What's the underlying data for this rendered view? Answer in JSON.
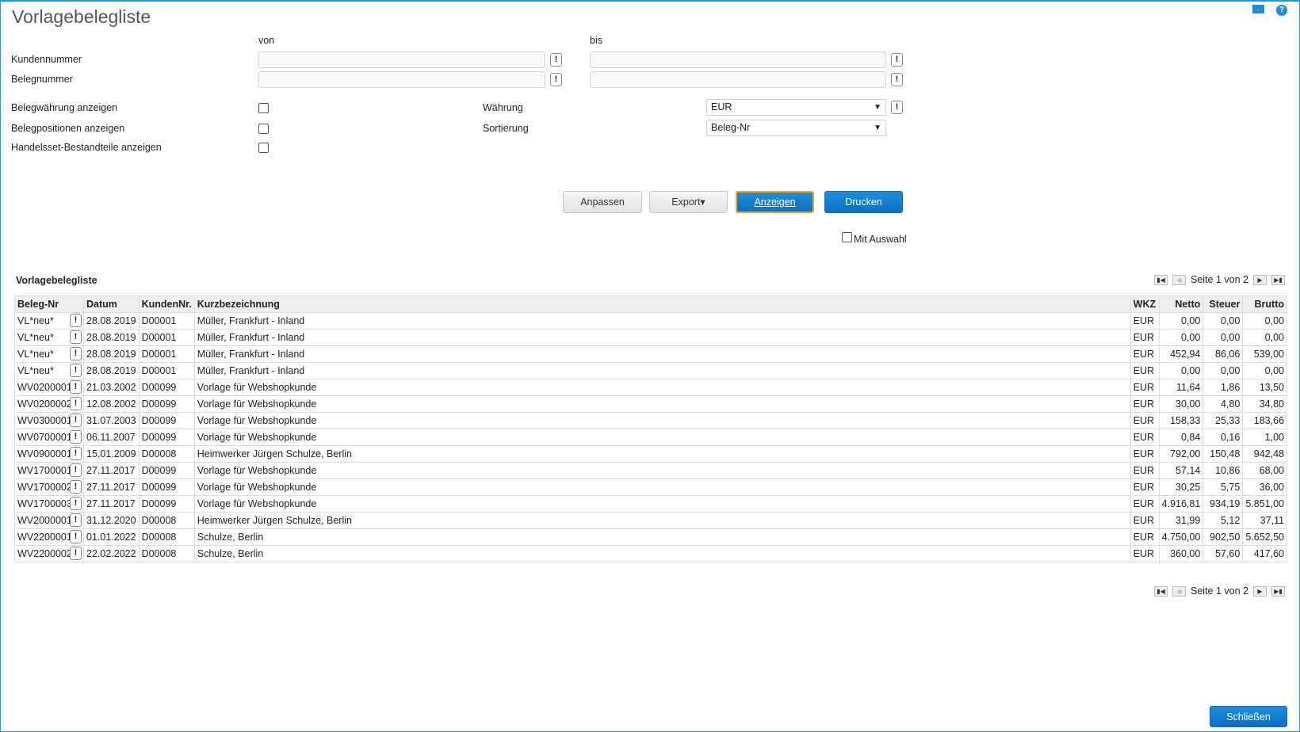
{
  "title": "Vorlagebelegliste",
  "top_icons": [
    "mail-icon",
    "help-icon"
  ],
  "filter": {
    "von": "von",
    "bis": "bis",
    "kundennummer": "Kundennummer",
    "belegnummer": "Belegnummer",
    "kunden_von": "",
    "kunden_bis": "",
    "beleg_von": "",
    "beleg_bis": "",
    "belegwaehrung": "Belegwährung anzeigen",
    "belegpositionen": "Belegpositionen anzeigen",
    "handelsset": "Handelsset-Bestandteile anzeigen",
    "waehrung_label": "Währung",
    "waehrung_value": "EUR",
    "sortierung_label": "Sortierung",
    "sortierung_value": "Beleg-Nr",
    "lookup": "!"
  },
  "buttons": {
    "anpassen": "Anpassen",
    "export": "Export▾",
    "anzeigen": "Anzeigen",
    "drucken": "Drucken",
    "mit_auswahl": "Mit Auswahl",
    "schliessen": "Schließen"
  },
  "list": {
    "heading": "Vorlagebelegliste",
    "pager": "Seite 1 von 2",
    "columns": [
      "Beleg-Nr",
      "Datum",
      "KundenNr.",
      "Kurzbezeichnung",
      "WKZ",
      "Netto",
      "Steuer",
      "Brutto"
    ],
    "rows": [
      [
        "VL*neu*",
        "28.08.2019",
        "D00001",
        "Müller, Frankfurt - Inland",
        "EUR",
        "0,00",
        "0,00",
        "0,00"
      ],
      [
        "VL*neu*",
        "28.08.2019",
        "D00001",
        "Müller, Frankfurt - Inland",
        "EUR",
        "0,00",
        "0,00",
        "0,00"
      ],
      [
        "VL*neu*",
        "28.08.2019",
        "D00001",
        "Müller, Frankfurt - Inland",
        "EUR",
        "452,94",
        "86,06",
        "539,00"
      ],
      [
        "VL*neu*",
        "28.08.2019",
        "D00001",
        "Müller, Frankfurt - Inland",
        "EUR",
        "0,00",
        "0,00",
        "0,00"
      ],
      [
        "WV0200001",
        "21.03.2002",
        "D00099",
        "Vorlage für Webshopkunde",
        "EUR",
        "11,64",
        "1,86",
        "13,50"
      ],
      [
        "WV0200002",
        "12.08.2002",
        "D00099",
        "Vorlage für Webshopkunde",
        "EUR",
        "30,00",
        "4,80",
        "34,80"
      ],
      [
        "WV0300001",
        "31.07.2003",
        "D00099",
        "Vorlage für Webshopkunde",
        "EUR",
        "158,33",
        "25,33",
        "183,66"
      ],
      [
        "WV0700001",
        "06.11.2007",
        "D00099",
        "Vorlage für Webshopkunde",
        "EUR",
        "0,84",
        "0,16",
        "1,00"
      ],
      [
        "WV0900001",
        "15.01.2009",
        "D00008",
        "Heimwerker Jürgen Schulze, Berlin",
        "EUR",
        "792,00",
        "150,48",
        "942,48"
      ],
      [
        "WV1700001",
        "27.11.2017",
        "D00099",
        "Vorlage für Webshopkunde",
        "EUR",
        "57,14",
        "10,86",
        "68,00"
      ],
      [
        "WV1700002",
        "27.11.2017",
        "D00099",
        "Vorlage für Webshopkunde",
        "EUR",
        "30,25",
        "5,75",
        "36,00"
      ],
      [
        "WV1700003",
        "27.11.2017",
        "D00099",
        "Vorlage für Webshopkunde",
        "EUR",
        "4.916,81",
        "934,19",
        "5.851,00"
      ],
      [
        "WV2000001",
        "31.12.2020",
        "D00008",
        "Heimwerker Jürgen Schulze, Berlin",
        "EUR",
        "31,99",
        "5,12",
        "37,11"
      ],
      [
        "WV2200001",
        "01.01.2022",
        "D00008",
        "Schulze, Berlin",
        "EUR",
        "4.750,00",
        "902,50",
        "5.652,50"
      ],
      [
        "WV2200002",
        "22.02.2022",
        "D00008",
        "Schulze, Berlin",
        "EUR",
        "360,00",
        "57,60",
        "417,60"
      ]
    ]
  }
}
